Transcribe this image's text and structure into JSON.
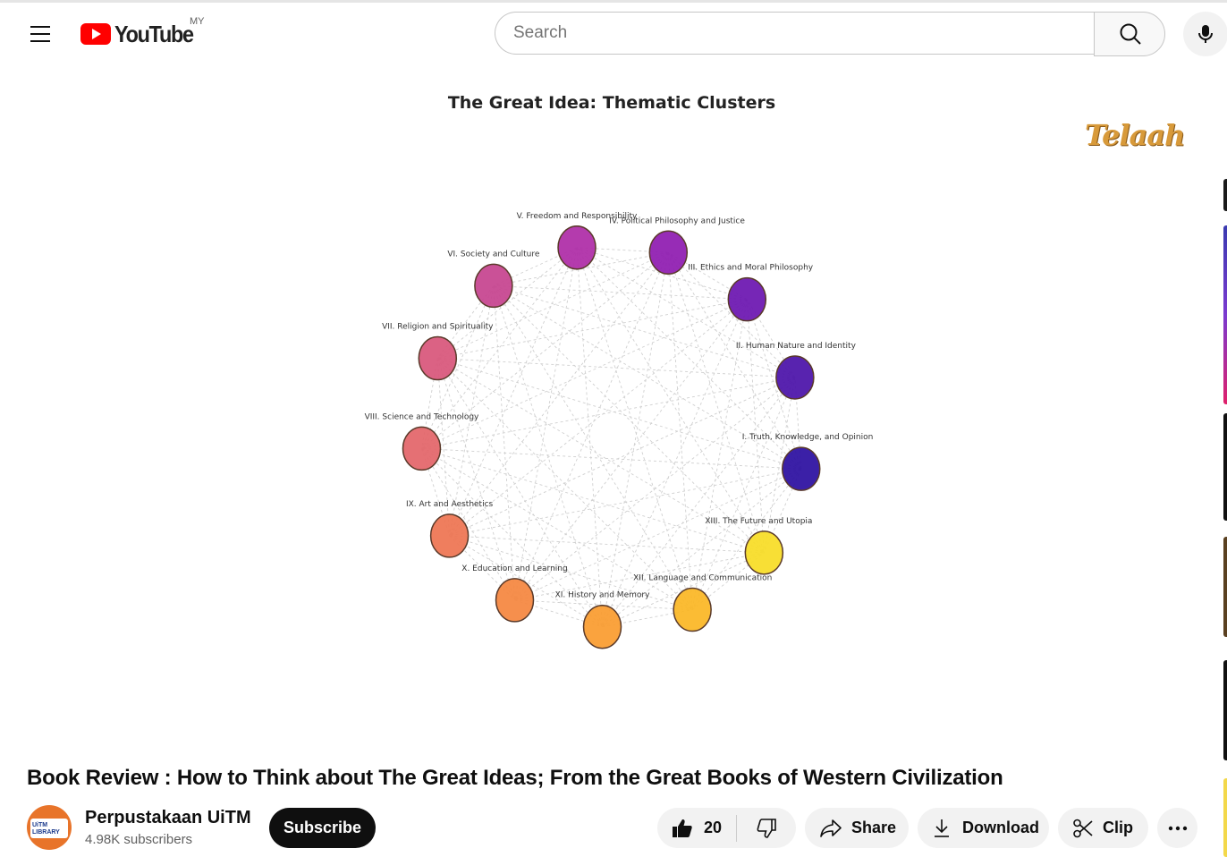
{
  "header": {
    "logo_text": "YouTube",
    "country_code": "MY",
    "search_placeholder": "Search"
  },
  "player": {
    "chart_title": "The Great Idea: Thematic Clusters",
    "watermark": "Telaah",
    "nodes": [
      {
        "label": "I. Truth, Knowledge, and Opinion",
        "color": "#2a0da0"
      },
      {
        "label": "II. Human Nature and Identity",
        "color": "#4a10a8"
      },
      {
        "label": "III. Ethics and Moral Philosophy",
        "color": "#6a14b0"
      },
      {
        "label": "IV. Political Philosophy and Justice",
        "color": "#8e1ab0"
      },
      {
        "label": "V. Freedom and Responsibility",
        "color": "#ae2aa6"
      },
      {
        "label": "VI. Society and Culture",
        "color": "#c6428e"
      },
      {
        "label": "VII. Religion and Spirituality",
        "color": "#d8557a"
      },
      {
        "label": "VIII. Science and Technology",
        "color": "#e36468"
      },
      {
        "label": "IX. Art and Aesthetics",
        "color": "#ee7350"
      },
      {
        "label": "X. Education and Learning",
        "color": "#f5853e"
      },
      {
        "label": "XI. History and Memory",
        "color": "#fa9b2e"
      },
      {
        "label": "XII. Language and Communication",
        "color": "#fbb623"
      },
      {
        "label": "XIII. The Future and Utopia",
        "color": "#f7dc24"
      }
    ]
  },
  "video": {
    "title": "Book Review : How to Think about The Great Ideas; From the Great Books of Western Civilization"
  },
  "channel": {
    "avatar_text_line1": "UiTM",
    "avatar_text_line2": "LIBRARY",
    "name": "Perpustakaan UiTM",
    "subscribers": "4.98K subscribers",
    "subscribe_label": "Subscribe"
  },
  "actions": {
    "like_count": "20",
    "share_label": "Share",
    "download_label": "Download",
    "clip_label": "Clip"
  }
}
